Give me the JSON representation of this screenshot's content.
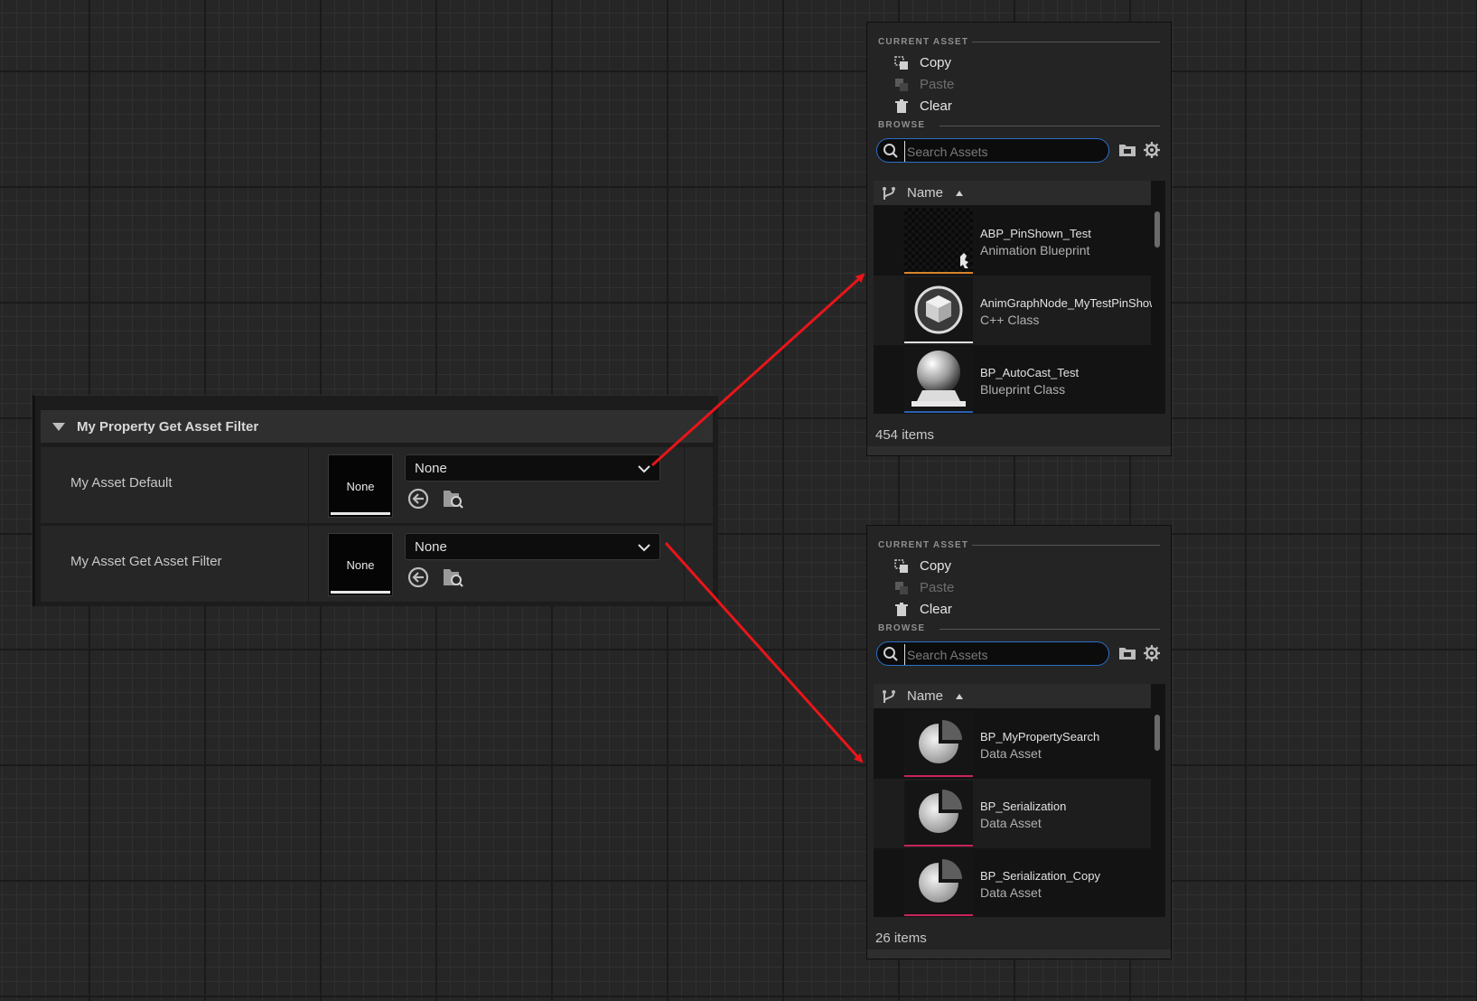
{
  "details": {
    "category_title": "My Property Get Asset Filter",
    "rows": [
      {
        "label": "My Asset Default",
        "thumb_text": "None",
        "combo_value": "None"
      },
      {
        "label": "My Asset Get Asset Filter",
        "thumb_text": "None",
        "combo_value": "None"
      }
    ]
  },
  "pickers": [
    {
      "current_asset_title": "CURRENT ASSET",
      "copy_label": "Copy",
      "paste_label": "Paste",
      "clear_label": "Clear",
      "browse_title": "BROWSE",
      "search_placeholder": "Search Assets",
      "column_name": "Name",
      "assets": [
        {
          "name": "ABP_PinShown_Test",
          "type": "Animation Blueprint",
          "icon": "anim-blueprint-icon",
          "underline_color": "#d9822b"
        },
        {
          "name": "AnimGraphNode_MyTestPinShown",
          "type": "C++ Class",
          "icon": "cube-icon",
          "underline_color": "#e0e0e0"
        },
        {
          "name": "BP_AutoCast_Test",
          "type": "Blueprint Class",
          "icon": "sphere-icon",
          "underline_color": "#2a5fb0"
        }
      ],
      "item_count": "454 items"
    },
    {
      "current_asset_title": "CURRENT ASSET",
      "copy_label": "Copy",
      "paste_label": "Paste",
      "clear_label": "Clear",
      "browse_title": "BROWSE",
      "search_placeholder": "Search Assets",
      "column_name": "Name",
      "assets": [
        {
          "name": "BP_MyPropertySearch",
          "type": "Data Asset",
          "icon": "pie-chart-icon",
          "underline_color": "#c8245a"
        },
        {
          "name": "BP_Serialization",
          "type": "Data Asset",
          "icon": "pie-chart-icon",
          "underline_color": "#c8245a"
        },
        {
          "name": "BP_Serialization_Copy",
          "type": "Data Asset",
          "icon": "pie-chart-icon",
          "underline_color": "#c8245a"
        }
      ],
      "item_count": "26 items"
    }
  ],
  "colors": {
    "arrow": "#e8151a",
    "search_border": "#2a6fc9",
    "background": "#262626"
  }
}
